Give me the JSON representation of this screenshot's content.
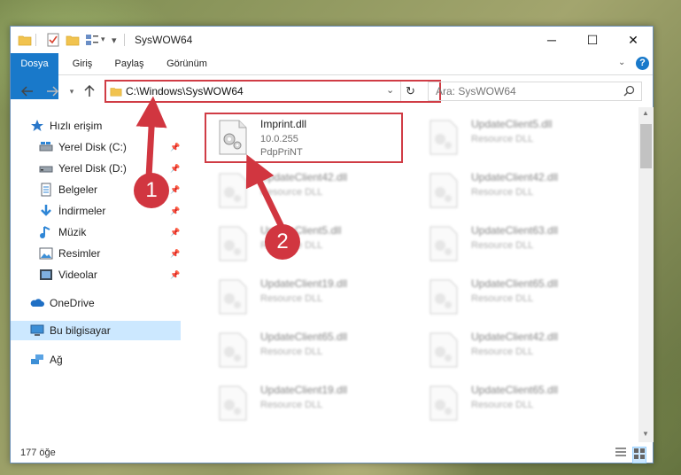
{
  "window": {
    "title": "SysWOW64",
    "controls": {
      "minimize": "─",
      "maximize": "☐",
      "close": "✕"
    }
  },
  "ribbon": {
    "tabs": [
      "Dosya",
      "Giriş",
      "Paylaş",
      "Görünüm"
    ]
  },
  "address": {
    "path": "C:\\Windows\\SysWOW64",
    "search_placeholder": "Ara: SysWOW64"
  },
  "nav": {
    "items": [
      {
        "label": "Hızlı erişim",
        "icon": "star-icon",
        "pinned": false
      },
      {
        "label": "Yerel Disk (C:)",
        "icon": "drive-icon",
        "pinned": true
      },
      {
        "label": "Yerel Disk (D:)",
        "icon": "drive-icon",
        "pinned": true
      },
      {
        "label": "Belgeler",
        "icon": "documents-icon",
        "pinned": true
      },
      {
        "label": "İndirmeler",
        "icon": "download-icon",
        "pinned": true
      },
      {
        "label": "Müzik",
        "icon": "music-icon",
        "pinned": true
      },
      {
        "label": "Resimler",
        "icon": "pictures-icon",
        "pinned": true
      },
      {
        "label": "Videolar",
        "icon": "videos-icon",
        "pinned": true
      },
      {
        "label": "OneDrive",
        "icon": "cloud-icon",
        "pinned": false
      },
      {
        "label": "Bu bilgisayar",
        "icon": "computer-icon",
        "pinned": false,
        "selected": true
      },
      {
        "label": "Ağ",
        "icon": "network-icon",
        "pinned": false
      }
    ]
  },
  "files": [
    {
      "name": "Imprint.dll",
      "line1": "10.0.255",
      "line2": "PdpPriNT",
      "highlighted": true
    },
    {
      "name": "UpdateClient5.dll",
      "line1": "Resource DLL",
      "blurred": true
    },
    {
      "name": "UpdateClient42.dll",
      "line1": "Resource DLL",
      "blurred": true
    },
    {
      "name": "UpdateClient42.dll",
      "line1": "Resource DLL",
      "blurred": true
    },
    {
      "name": "UpdateClient5.dll",
      "line1": "Resource DLL",
      "blurred": true
    },
    {
      "name": "UpdateClient63.dll",
      "line1": "Resource DLL",
      "blurred": true
    },
    {
      "name": "UpdateClient19.dll",
      "line1": "Resource DLL",
      "blurred": true
    },
    {
      "name": "UpdateClient65.dll",
      "line1": "Resource DLL",
      "blurred": true
    },
    {
      "name": "UpdateClient65.dll",
      "line1": "Resource DLL",
      "blurred": true
    },
    {
      "name": "UpdateClient42.dll",
      "line1": "Resource DLL",
      "blurred": true
    },
    {
      "name": "UpdateClient19.dll",
      "line1": "Resource DLL",
      "blurred": true
    },
    {
      "name": "UpdateClient65.dll",
      "line1": "Resource DLL",
      "blurred": true
    }
  ],
  "status": {
    "item_count": "177 öğe"
  },
  "annotations": {
    "step1": "1",
    "step2": "2",
    "color": "#d13640"
  }
}
